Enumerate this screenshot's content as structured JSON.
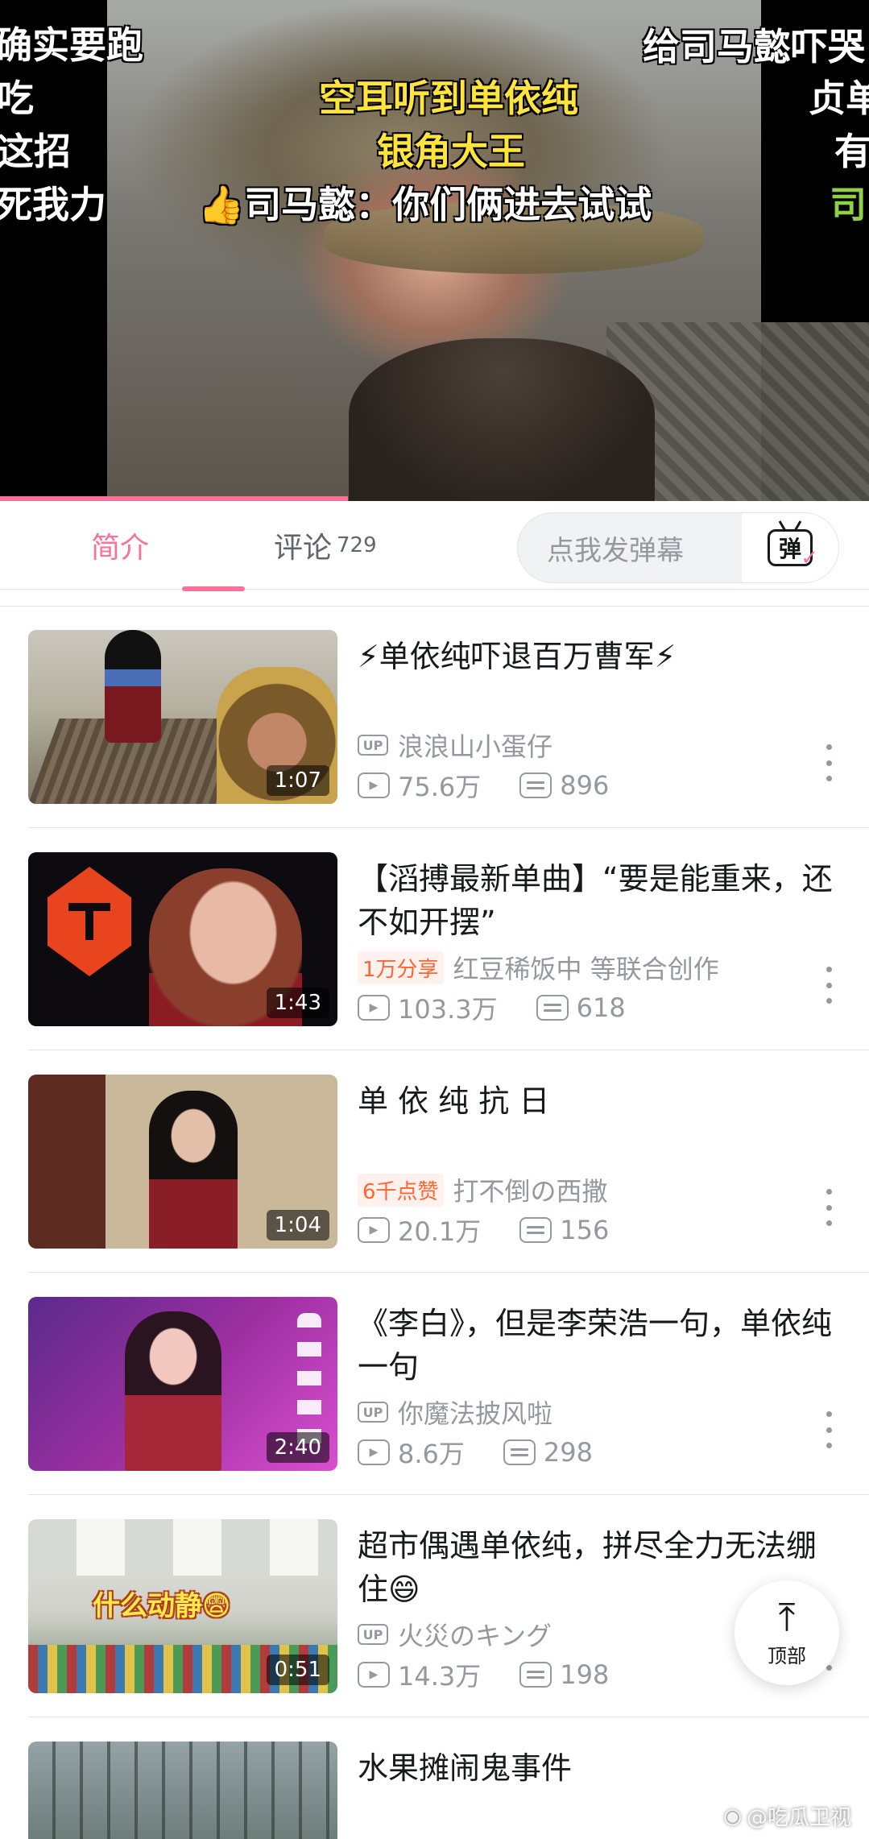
{
  "player": {
    "danmaku": [
      {
        "text": "确实要跑",
        "style": "white"
      },
      {
        "text": "吃",
        "style": "white"
      },
      {
        "text": "这招",
        "style": "white"
      },
      {
        "text": "死我力",
        "style": "white"
      },
      {
        "text": "给司马懿吓哭",
        "style": "white"
      },
      {
        "text": "贞单",
        "style": "white"
      },
      {
        "text": "有",
        "style": "white"
      },
      {
        "text": "司",
        "style": "green"
      },
      {
        "text": "空耳听到单依纯",
        "style": "yellow"
      },
      {
        "text": "银角大王",
        "style": "yellow"
      },
      {
        "text": "司马懿：你们俩进去试试",
        "style": "white",
        "icon": "thumbs-up-icon"
      }
    ],
    "progress": 0.4
  },
  "tabs": {
    "intro_label": "简介",
    "comments_label": "评论",
    "comments_count": "729",
    "danmaku_placeholder": "点我发弹幕",
    "danmaku_button_glyph": "弹"
  },
  "videos": [
    {
      "title": "⚡单依纯吓退百万曹军⚡",
      "duration": "1:07",
      "owner_badge": "UP",
      "owner": "浪浪山小蛋仔",
      "tag": "",
      "views": "75.6万",
      "danmaku": "896"
    },
    {
      "title": "【滔搏最新单曲】“要是能重来，还不如开摆”",
      "duration": "1:43",
      "owner_badge": "",
      "owner": "红豆稀饭中 等联合创作",
      "tag": "1万分享",
      "views": "103.3万",
      "danmaku": "618"
    },
    {
      "title": "单 依 纯 抗 日",
      "duration": "1:04",
      "owner_badge": "",
      "owner": "打不倒の西撒",
      "tag": "6千点赞",
      "views": "20.1万",
      "danmaku": "156"
    },
    {
      "title": "《李白》，但是李荣浩一句，单依纯一句",
      "duration": "2:40",
      "owner_badge": "UP",
      "owner": "你魔法披风啦",
      "tag": "",
      "views": "8.6万",
      "danmaku": "298"
    },
    {
      "title": "超市偶遇单依纯，拼尽全力无法绷住😄",
      "duration": "0:51",
      "owner_badge": "UP",
      "owner": "火災のキング",
      "tag": "",
      "views": "14.3万",
      "danmaku": "198",
      "cover_caption": "什么动静😨"
    },
    {
      "title": "水果摊闹鬼事件",
      "duration": "",
      "owner_badge": "",
      "owner": "",
      "tag": "",
      "views": "",
      "danmaku": ""
    }
  ],
  "top_button": {
    "arrow": "⤒",
    "label": "顶部"
  },
  "watermark": "@吃瓜卫视",
  "colors": {
    "accent": "#fb7299",
    "tag_text": "#ff6633",
    "tag_bg": "#fff1ed",
    "muted": "#9499a0"
  }
}
